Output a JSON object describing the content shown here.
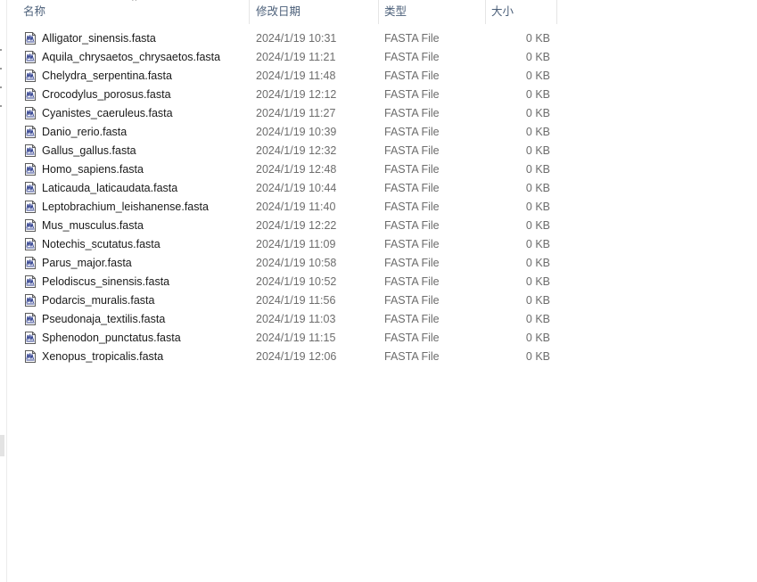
{
  "columns": {
    "name": "名称",
    "date": "修改日期",
    "type": "类型",
    "size": "大小"
  },
  "sort": {
    "column": "name",
    "direction": "ascending"
  },
  "files": [
    {
      "name": "Alligator_sinensis.fasta",
      "date": "2024/1/19 10:31",
      "type": "FASTA File",
      "size": "0 KB"
    },
    {
      "name": "Aquila_chrysaetos_chrysaetos.fasta",
      "date": "2024/1/19 11:21",
      "type": "FASTA File",
      "size": "0 KB"
    },
    {
      "name": "Chelydra_serpentina.fasta",
      "date": "2024/1/19 11:48",
      "type": "FASTA File",
      "size": "0 KB"
    },
    {
      "name": "Crocodylus_porosus.fasta",
      "date": "2024/1/19 12:12",
      "type": "FASTA File",
      "size": "0 KB"
    },
    {
      "name": "Cyanistes_caeruleus.fasta",
      "date": "2024/1/19 11:27",
      "type": "FASTA File",
      "size": "0 KB"
    },
    {
      "name": "Danio_rerio.fasta",
      "date": "2024/1/19 10:39",
      "type": "FASTA File",
      "size": "0 KB"
    },
    {
      "name": "Gallus_gallus.fasta",
      "date": "2024/1/19 12:32",
      "type": "FASTA File",
      "size": "0 KB"
    },
    {
      "name": "Homo_sapiens.fasta",
      "date": "2024/1/19 12:48",
      "type": "FASTA File",
      "size": "0 KB"
    },
    {
      "name": "Laticauda_laticaudata.fasta",
      "date": "2024/1/19 10:44",
      "type": "FASTA File",
      "size": "0 KB"
    },
    {
      "name": "Leptobrachium_leishanense.fasta",
      "date": "2024/1/19 11:40",
      "type": "FASTA File",
      "size": "0 KB"
    },
    {
      "name": "Mus_musculus.fasta",
      "date": "2024/1/19 12:22",
      "type": "FASTA File",
      "size": "0 KB"
    },
    {
      "name": "Notechis_scutatus.fasta",
      "date": "2024/1/19 11:09",
      "type": "FASTA File",
      "size": "0 KB"
    },
    {
      "name": "Parus_major.fasta",
      "date": "2024/1/19 10:58",
      "type": "FASTA File",
      "size": "0 KB"
    },
    {
      "name": "Pelodiscus_sinensis.fasta",
      "date": "2024/1/19 10:52",
      "type": "FASTA File",
      "size": "0 KB"
    },
    {
      "name": "Podarcis_muralis.fasta",
      "date": "2024/1/19 11:56",
      "type": "FASTA File",
      "size": "0 KB"
    },
    {
      "name": "Pseudonaja_textilis.fasta",
      "date": "2024/1/19 11:03",
      "type": "FASTA File",
      "size": "0 KB"
    },
    {
      "name": "Sphenodon_punctatus.fasta",
      "date": "2024/1/19 11:15",
      "type": "FASTA File",
      "size": "0 KB"
    },
    {
      "name": "Xenopus_tropicalis.fasta",
      "date": "2024/1/19 12:06",
      "type": "FASTA File",
      "size": "0 KB"
    }
  ],
  "icons": {
    "file": "fasta-file-icon",
    "sort": "sort-ascending-icon"
  },
  "colors": {
    "header_text": "#4c607a",
    "secondary_text": "#6d6d6d",
    "file_icon_accent": "#2f3f8f"
  }
}
